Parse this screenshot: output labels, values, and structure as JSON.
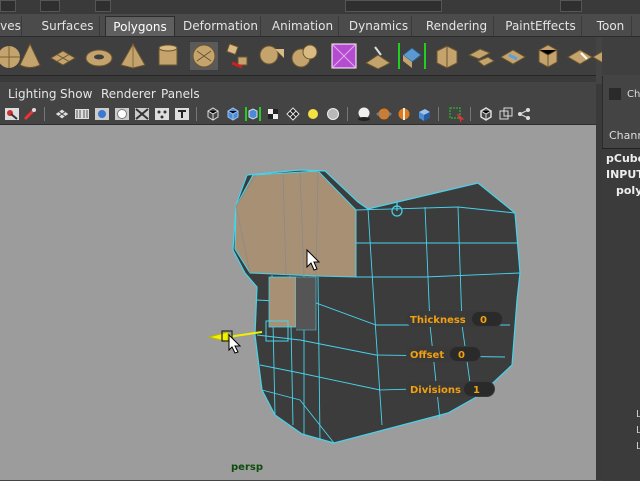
{
  "tabs": {
    "items": [
      {
        "label": "ves"
      },
      {
        "label": "Surfaces"
      },
      {
        "label": "Polygons"
      },
      {
        "label": "Deformation"
      },
      {
        "label": "Animation"
      },
      {
        "label": "Dynamics"
      },
      {
        "label": "Rendering"
      },
      {
        "label": "PaintEffects"
      },
      {
        "label": "Toon"
      }
    ],
    "active": "Polygons"
  },
  "panel_menu": {
    "lighting": "Lighting",
    "show": "Show",
    "renderer": "Renderer",
    "panels": "Panels"
  },
  "viewport": {
    "camera": "persp",
    "background": "#9c9c9c",
    "hud": {
      "thickness_label": "Thickness",
      "thickness_value": "0",
      "offset_label": "Offset",
      "offset_value": "0",
      "divisions_label": "Divisions",
      "divisions_value": "1"
    },
    "colors": {
      "wire": "#46d4ec",
      "mesh": "#3b3b3b",
      "selected": "#a89074",
      "hud_text": "#f2a010",
      "manipulator": "#f0f000"
    }
  },
  "channel_box": {
    "tab_label": "Ch",
    "title": "Chann",
    "object": "pCube",
    "inputs": "INPUT",
    "node": "poly",
    "left_labels": [
      "L",
      "L",
      "L"
    ]
  },
  "icons": {
    "shelf": [
      "sphere-icon",
      "cone-icon",
      "plane-icon",
      "torus-icon",
      "pyramid-icon",
      "cylinder-icon",
      "combine-icon",
      "smooth-icon",
      "separate-icon",
      "extract-icon",
      "extrude-icon",
      "bevel-icon",
      "subdiv-cube-icon",
      "split-polygon-icon",
      "wedge-icon",
      "bridge-icon",
      "merge-icon",
      "append-icon",
      "poke-icon",
      "duplicate-face-icon",
      "cut-icon",
      "soften-icon",
      "harden-icon",
      "sculpt-icon"
    ],
    "panel_toolbar": [
      "camera-icon",
      "grid-icon",
      "light-icon",
      "film-gate-icon",
      "safe-action-icon",
      "resolution-gate-icon",
      "text-icon",
      "wireframe-icon",
      "shaded-icon",
      "wireframe-on-shaded-icon",
      "textured-icon",
      "default-light-icon",
      "all-lights-icon",
      "shadows-icon",
      "high-quality-icon",
      "isolate-icon",
      "xray-icon",
      "bounding-box-icon",
      "backface-icon",
      "node-icon"
    ]
  }
}
